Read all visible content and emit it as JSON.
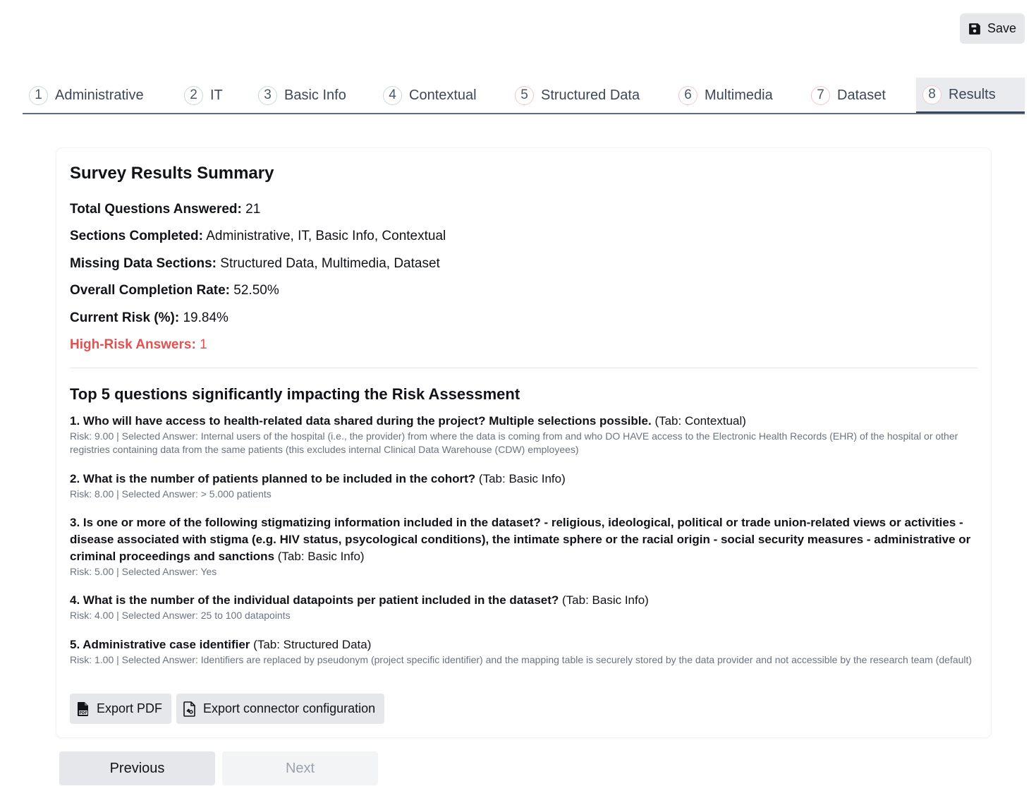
{
  "header": {
    "save_label": "Save"
  },
  "tabs": [
    {
      "num": "1",
      "label": "Administrative"
    },
    {
      "num": "2",
      "label": "IT"
    },
    {
      "num": "3",
      "label": "Basic Info"
    },
    {
      "num": "4",
      "label": "Contextual"
    },
    {
      "num": "5",
      "label": "Structured Data"
    },
    {
      "num": "6",
      "label": "Multimedia"
    },
    {
      "num": "7",
      "label": "Dataset"
    },
    {
      "num": "8",
      "label": "Results"
    }
  ],
  "summary": {
    "title": "Survey Results Summary",
    "total_label": "Total Questions Answered:",
    "total_value": "21",
    "sections_label": "Sections Completed:",
    "sections_value": "Administrative, IT, Basic Info, Contextual",
    "missing_label": "Missing Data Sections:",
    "missing_value": "Structured Data, Multimedia, Dataset",
    "completion_label": "Overall Completion Rate:",
    "completion_value": "52.50%",
    "risk_label": "Current Risk (%):",
    "risk_value": "19.84%",
    "high_risk_label": "High-Risk Answers:",
    "high_risk_value": "1"
  },
  "top": {
    "title": "Top 5 questions significantly impacting the Risk Assessment",
    "questions": [
      {
        "question": "1. Who will have access to health-related data shared during the project? Multiple selections possible.",
        "tab": "(Tab: Contextual)",
        "meta": "Risk: 9.00 | Selected Answer: Internal users of the hospital (i.e., the provider) from where the data is coming from and who DO HAVE access to the Electronic Health Records (EHR) of the hospital or other registries containing data from the same patients (this excludes internal Clinical Data Warehouse (CDW) employees)"
      },
      {
        "question": "2. What is the number of patients planned to be included in the cohort?",
        "tab": "(Tab: Basic Info)",
        "meta": "Risk: 8.00 | Selected Answer: > 5.000 patients"
      },
      {
        "question": "3. Is one or more of the following stigmatizing information included in the dataset? - religious, ideological, political or trade union-related views or activities - disease associated with stigma (e.g. HIV status, psycological conditions), the intimate sphere or the racial origin - social security measures - administrative or criminal proceedings and sanctions",
        "tab": "(Tab: Basic Info)",
        "meta": "Risk: 5.00 | Selected Answer: Yes"
      },
      {
        "question": "4. What is the number of the individual datapoints per patient included in the dataset?",
        "tab": "(Tab: Basic Info)",
        "meta": "Risk: 4.00 | Selected Answer: 25 to 100 datapoints"
      },
      {
        "question": "5. Administrative case identifier",
        "tab": "(Tab: Structured Data)",
        "meta": "Risk: 1.00 | Selected Answer: Identifiers are replaced by pseudonym (project specific identifier) and the mapping table is securely stored by the data provider and not accessible by the research team (default)"
      }
    ]
  },
  "actions": {
    "export_pdf": "Export PDF",
    "export_connector": "Export connector configuration"
  },
  "nav": {
    "previous": "Previous",
    "next": "Next"
  },
  "colors": {
    "accent_risk": "#e05252",
    "active_tab_underline": "#334155"
  }
}
